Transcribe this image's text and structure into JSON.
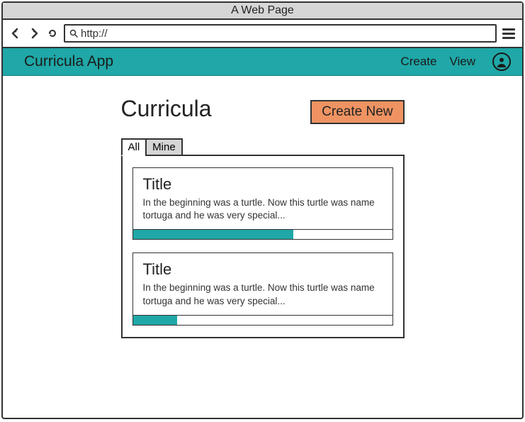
{
  "browser": {
    "window_title": "A Web Page",
    "url_prefix": "http://"
  },
  "appbar": {
    "title": "Curricula App",
    "links": {
      "create": "Create",
      "view": "View"
    }
  },
  "page": {
    "heading": "Curricula",
    "create_button": "Create New",
    "tabs": {
      "all": "All",
      "mine": "Mine",
      "active": "all"
    }
  },
  "cards": [
    {
      "title": "Title",
      "description": "In the beginning was a turtle. Now this turtle was name tortuga and he was very special...",
      "progress_percent": 62
    },
    {
      "title": "Title",
      "description": "In the beginning was a turtle. Now this turtle was name tortuga and he was very special...",
      "progress_percent": 17
    }
  ],
  "colors": {
    "accent": "#20a7a7",
    "primary_button": "#ef9362"
  }
}
